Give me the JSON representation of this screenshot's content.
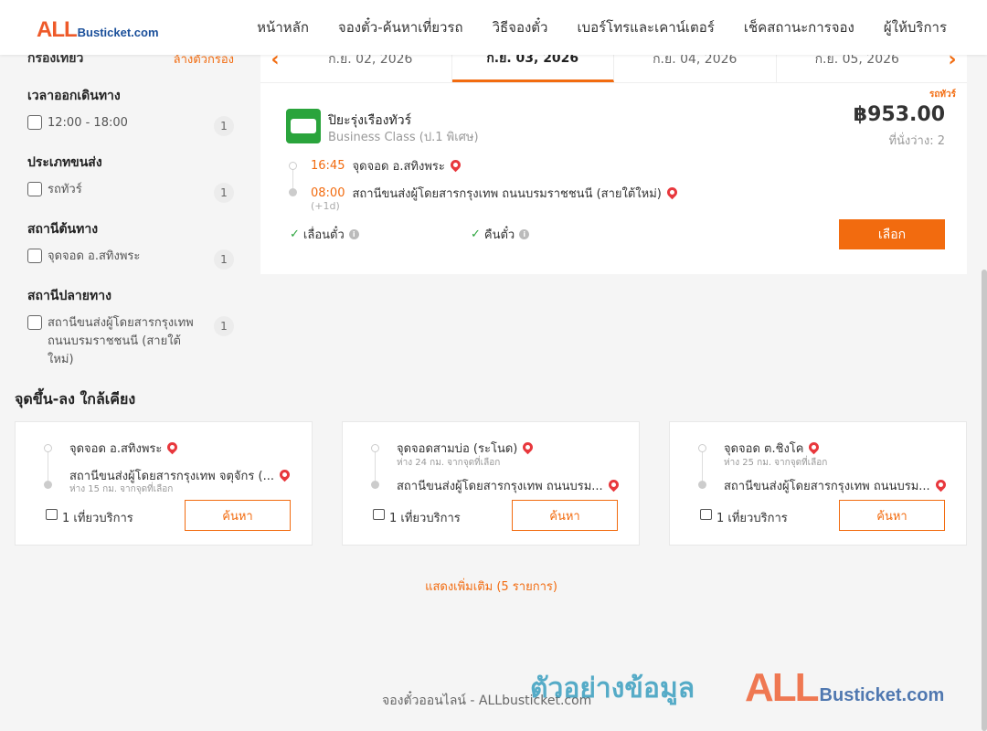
{
  "header": {
    "logo_main": "ALL",
    "logo_rest": "Busticket.com",
    "nav": [
      "หน้าหลัก",
      "จองตั๋ว-ค้นหาเที่ยวรถ",
      "วิธีจองตั๋ว",
      "เบอร์โทรและเคาน์เตอร์",
      "เช็คสถานะการจอง",
      "ผู้ให้บริการ"
    ]
  },
  "filters": {
    "title": "กรองเที่ยว",
    "clear": "ล้างตัวกรอง",
    "groups": [
      {
        "title": "เวลาออกเดินทาง",
        "options": [
          {
            "label": "12:00 - 18:00",
            "count": "1"
          }
        ]
      },
      {
        "title": "ประเภทขนส่ง",
        "options": [
          {
            "label": "รถทัวร์",
            "count": "1"
          }
        ]
      },
      {
        "title": "สถานีต้นทาง",
        "options": [
          {
            "label": "จุดจอด อ.สทิงพระ",
            "count": "1"
          }
        ]
      },
      {
        "title": "สถานีปลายทาง",
        "options": [
          {
            "label": "สถานีขนส่งผู้โดยสารกรุงเทพ ถนนบรมราชชนนี (สายใต้ใหม่)",
            "count": "1"
          }
        ]
      }
    ]
  },
  "dates": {
    "tabs": [
      "ก.ย. 02, 2026",
      "ก.ย. 03, 2026",
      "ก.ย. 04, 2026",
      "ก.ย. 05, 2026"
    ],
    "active_index": 1
  },
  "trip": {
    "tag": "รถทัวร์",
    "operator": "ปิยะรุ่งเรืองทัวร์",
    "class": "Business Class (ป.1 พิเศษ)",
    "price": "฿953.00",
    "seats": "ที่นั่งว่าง: 2",
    "depart_time": "16:45",
    "depart_stop": "จุดจอด อ.สทิงพระ",
    "arrive_time": "08:00",
    "arrive_stop": "สถานีขนส่งผู้โดยสารกรุงเทพ ถนนบรมราชชนนี (สายใต้ใหม่)",
    "plus_day": "(+1d)",
    "feature1": "เลื่อนตั๋ว",
    "feature2": "คืนตั๋ว",
    "select_label": "เลือก"
  },
  "nearby": {
    "title": "จุดขึ้น-ลง ใกล้เคียง",
    "cards": [
      {
        "from": "จุดจอด อ.สทิงพระ",
        "from_sub": "",
        "to": "สถานีขนส่งผู้โดยสารกรุงเทพ จตุจักร (...",
        "to_sub": "ห่าง 15 กม. จากจุดที่เลือก",
        "services": "1 เที่ยวบริการ",
        "button": "ค้นหา"
      },
      {
        "from": "จุดจอดสามบ่อ (ระโนด)",
        "from_sub": "ห่าง 24 กม. จากจุดที่เลือก",
        "to": "สถานีขนส่งผู้โดยสารกรุงเทพ ถนนบรม...",
        "to_sub": "",
        "services": "1 เที่ยวบริการ",
        "button": "ค้นหา"
      },
      {
        "from": "จุดจอด ต.ชิงโค",
        "from_sub": "ห่าง 25 กม. จากจุดที่เลือก",
        "to": "สถานีขนส่งผู้โดยสารกรุงเทพ ถนนบรม...",
        "to_sub": "",
        "services": "1 เที่ยวบริการ",
        "button": "ค้นหา"
      }
    ],
    "show_more": "แสดงเพิ่มเติม (5 รายการ)"
  },
  "footer": {
    "text": "จองตั๋วออนไลน์ - ALLbusticket.com",
    "watermark_th": "ตัวอย่างข้อมูล",
    "watermark_all": "ALL",
    "watermark_rest": "Busticket.com"
  },
  "colors": {
    "accent": "#f26b0f",
    "brand_red": "#ee5a2a",
    "brand_blue": "#1a4f9a",
    "operator_green": "#2aa43c"
  },
  "icons": [
    "location-pin-icon",
    "bus-icon",
    "info-icon",
    "check-icon",
    "chevron-left-icon",
    "chevron-right-icon"
  ]
}
